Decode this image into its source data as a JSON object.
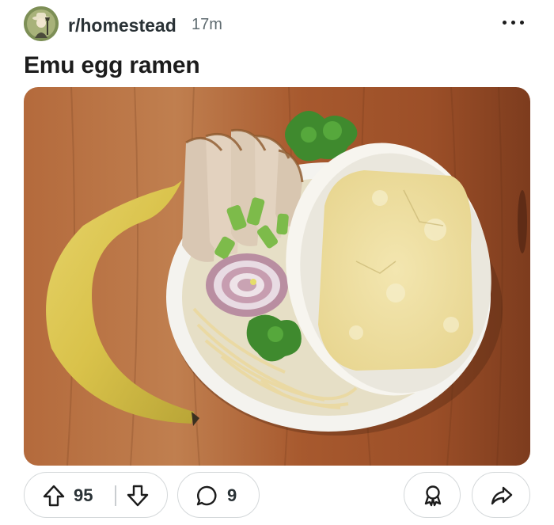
{
  "post": {
    "subreddit": "r/homestead",
    "time_ago": "17m",
    "title": "Emu egg ramen"
  },
  "actions": {
    "upvote_count": "95",
    "comment_count": "9"
  },
  "icons": {
    "more": "more-options-icon",
    "upvote": "arrow-up-icon",
    "downvote": "arrow-down-icon",
    "comment": "speech-bubble-icon",
    "award": "award-icon",
    "share": "share-arrow-icon"
  },
  "colors": {
    "text": "#1c1c1c",
    "muted": "#5f6b70",
    "border": "#d4d8da",
    "avatar_bg": "#7d8f56"
  }
}
